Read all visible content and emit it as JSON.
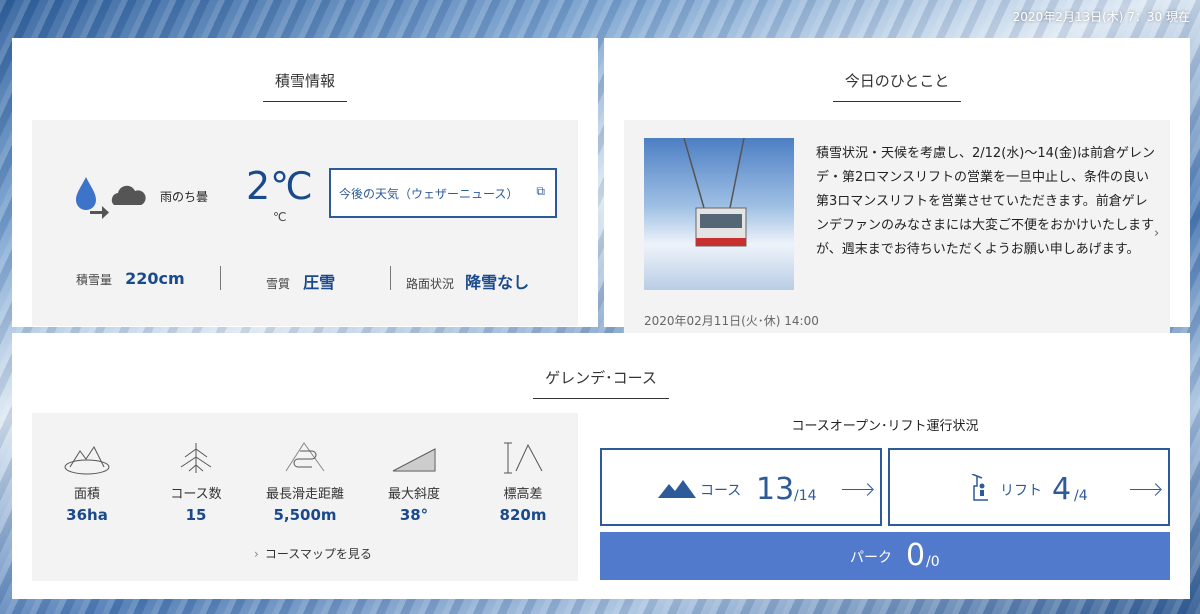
{
  "timestamp": "2020年2月13日(木) 7：30 現在",
  "snow": {
    "title": "積雪情報",
    "weather_label": "雨のち曇",
    "temp_value": "2℃",
    "temp_unit": "℃",
    "forecast_link": "今後の天気（ウェザーニュース）",
    "depth_label": "積雪量",
    "depth_value": "220cm",
    "quality_label": "雪質",
    "quality_value": "圧雪",
    "road_label": "路面状況",
    "road_value": "降雪なし"
  },
  "news": {
    "title": "今日のひとこと",
    "body": "積雪状況・天候を考慮し、2/12(水)～14(金)は前倉ゲレンデ・第2ロマンスリフトの営業を一旦中止し、条件の良い第3ロマンスリフトを営業させていただきます。前倉ゲレンデファンのみなさまには大変ご不便をおかけいたしますが、週末までお待ちいただくようお願い申しあげます。",
    "date": "2020年02月11日(火･休) 14:00"
  },
  "course": {
    "title": "ゲレンデ･コース",
    "stats": [
      {
        "icon": "area-icon",
        "label": "面積",
        "value": "36ha"
      },
      {
        "icon": "tree-icon",
        "label": "コース数",
        "value": "15"
      },
      {
        "icon": "winding-course-icon",
        "label": "最長滑走距離",
        "value": "5,500m"
      },
      {
        "icon": "slope-icon",
        "label": "最大斜度",
        "value": "38°"
      },
      {
        "icon": "elevation-icon",
        "label": "標高差",
        "value": "820m"
      }
    ],
    "map_link": "コースマップを見る",
    "status_title": "コースオープン･リフト運行状況",
    "courses_label": "コース",
    "courses_open": "13",
    "courses_total": "/14",
    "lifts_label": "リフト",
    "lifts_open": "4",
    "lifts_total": "/4",
    "park_label": "パーク",
    "park_open": "0",
    "park_total": "/0"
  },
  "colors": {
    "accent": "#2d5a99",
    "park_bg": "#5179cc",
    "value_text": "#1a4a8c"
  }
}
